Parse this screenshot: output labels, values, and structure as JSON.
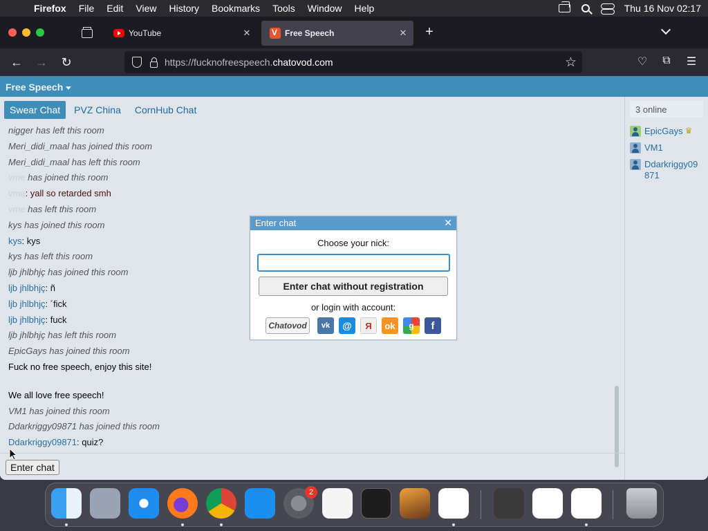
{
  "menubar": {
    "app_name": "Firefox",
    "items": [
      "File",
      "Edit",
      "View",
      "History",
      "Bookmarks",
      "Tools",
      "Window",
      "Help"
    ],
    "datetime": "Thu 16 Nov  02:17"
  },
  "browser": {
    "tabs": [
      {
        "title": "YouTube",
        "icon": "youtube-icon"
      },
      {
        "title": "Free Speech",
        "icon": "chatovod-icon",
        "active": true
      }
    ],
    "url_prefix": "https://fucknofreespeech.",
    "url_host": "chatovod.com"
  },
  "site": {
    "title": "Free Speech",
    "rooms": [
      "Swear Chat",
      "PVZ China",
      "CornHub Chat"
    ],
    "active_room": "Swear Chat",
    "messages": [
      {
        "type": "sys",
        "text": "nigger has left this room"
      },
      {
        "type": "sys",
        "text": "Meri_didi_maal has joined this room"
      },
      {
        "type": "sys",
        "text": "Meri_didi_maal has left this room"
      },
      {
        "type": "sys_blur",
        "blur": "vme",
        "text": " has joined this room"
      },
      {
        "type": "msg_blur",
        "blur": "vme",
        "text": ": yall so retarded smh"
      },
      {
        "type": "sys_blur",
        "blur": "vme",
        "text": " has left this room"
      },
      {
        "type": "sys",
        "text": "kys has joined this room"
      },
      {
        "type": "msg",
        "nick": "kys",
        "text": ": kys"
      },
      {
        "type": "sys",
        "text": "kys has left this room"
      },
      {
        "type": "sys",
        "text": "ljb jhlbhjç has joined this room"
      },
      {
        "type": "msg",
        "nick": "ljb jhlbhjç",
        "text": ": ñ"
      },
      {
        "type": "msg",
        "nick": "ljb jhlbhjç",
        "text": ": ´fick"
      },
      {
        "type": "msg",
        "nick": "ljb jhlbhjç",
        "text": ": fuck"
      },
      {
        "type": "sys",
        "text": "ljb jhlbhjç has left this room"
      },
      {
        "type": "sys",
        "text": "EpicGays has joined this room"
      },
      {
        "type": "plain",
        "text": "Fuck no free speech, enjoy this site!"
      },
      {
        "type": "gap",
        "text": ""
      },
      {
        "type": "plain",
        "text": "We all love free speech!"
      },
      {
        "type": "sys",
        "text": "VM1 has joined this room"
      },
      {
        "type": "sys",
        "text": "Ddarkriggy09871 has joined this room"
      },
      {
        "type": "msg",
        "nick": "Ddarkriggy09871",
        "text": ": quiz?"
      }
    ],
    "enter_chat_label": "Enter chat",
    "online_count": "3 online",
    "users": [
      {
        "name": "EpicGays",
        "icon": "user-icon-green",
        "crown": true
      },
      {
        "name": "VM1",
        "icon": "user-icon"
      },
      {
        "name": "Ddarkriggy09\n871",
        "icon": "user-icon"
      }
    ]
  },
  "modal": {
    "title": "Enter chat",
    "nick_label": "Choose your nick:",
    "nick_value": "",
    "enter_button": "Enter chat without registration",
    "login_label": "or login with account:",
    "providers": [
      "Chatovod",
      "VK",
      "Mail.ru",
      "Yandex",
      "Odnoklassniki",
      "Google",
      "Facebook"
    ]
  },
  "dock": {
    "apps": [
      "Finder",
      "Launchpad",
      "Safari",
      "Firefox",
      "Chrome",
      "App Store",
      "System Settings",
      "TextEdit",
      "Terminal",
      "GarageBand",
      "VS Code",
      "Keychain Access",
      "Home",
      "Visual Studio",
      "Trash"
    ],
    "settings_badge": "2"
  }
}
